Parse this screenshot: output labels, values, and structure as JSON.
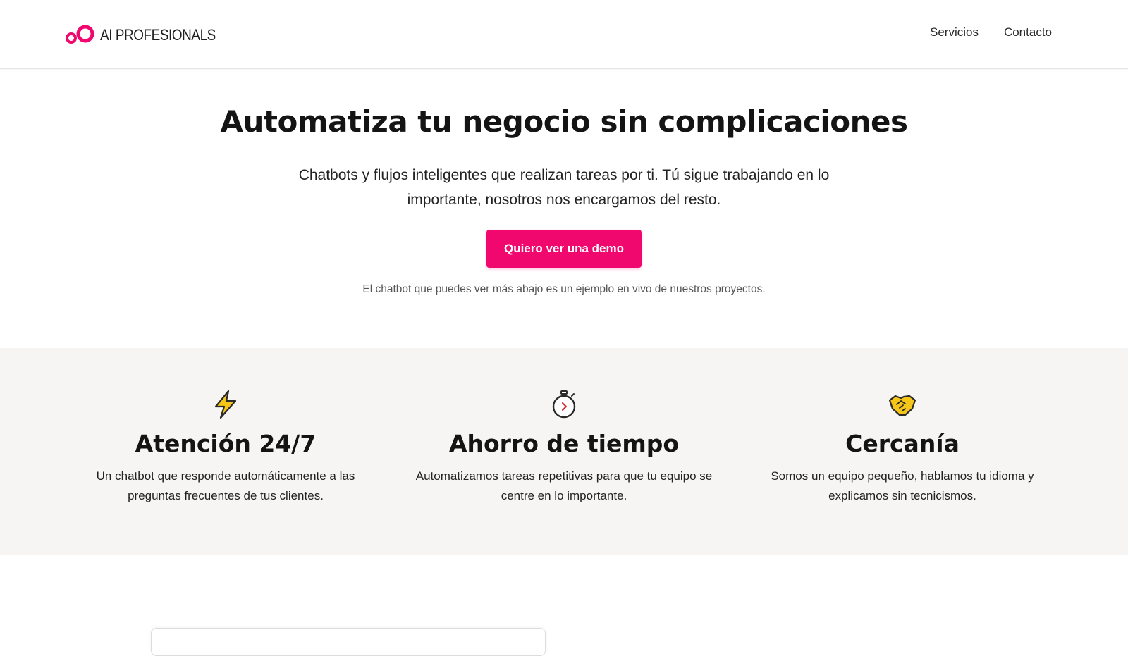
{
  "header": {
    "brand": "AI PROFESIONALS",
    "nav": [
      {
        "label": "Servicios"
      },
      {
        "label": "Contacto"
      }
    ]
  },
  "hero": {
    "title": "Automatiza tu negocio sin complicaciones",
    "subtitle": "Chatbots y flujos inteligentes que realizan tareas por ti. Tú sigue trabajando en lo importante, nosotros nos encargamos del resto.",
    "cta_label": "Quiero ver una demo",
    "note": "El chatbot que puedes ver más abajo es un ejemplo en vivo de nuestros proyectos."
  },
  "features": [
    {
      "icon": "lightning-icon",
      "title": "Atención 24/7",
      "text": "Un chatbot que responde automáticamente a las preguntas frecuentes de tus clientes."
    },
    {
      "icon": "stopwatch-icon",
      "title": "Ahorro de tiempo",
      "text": "Automatizamos tareas repetitivas para que tu equipo se centre en lo importante."
    },
    {
      "icon": "handshake-icon",
      "title": "Cercanía",
      "text": "Somos un equipo pequeño, hablamos tu idioma y explicamos sin tecnicismos."
    }
  ],
  "colors": {
    "accent": "#f0086e",
    "features_background": "#f6f5f3",
    "icon_yellow": "#f5c518"
  }
}
